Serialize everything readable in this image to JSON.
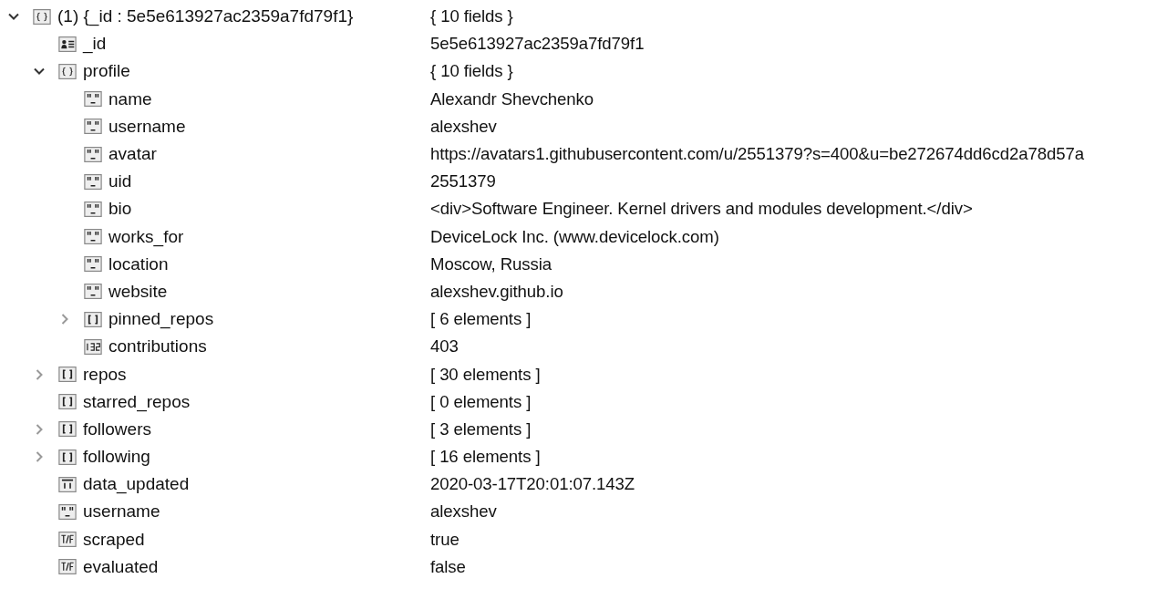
{
  "tree": [
    {
      "key": "(1) {_id : 5e5e613927ac2359a7fd79f1}",
      "value": "{ 10 fields }",
      "kind": "object",
      "expanded": true,
      "children": [
        {
          "key": "_id",
          "value": "5e5e613927ac2359a7fd79f1",
          "kind": "objectid"
        },
        {
          "key": "profile",
          "value": "{ 10 fields }",
          "kind": "object",
          "expanded": true,
          "children": [
            {
              "key": "name",
              "value": "Alexandr Shevchenko",
              "kind": "string"
            },
            {
              "key": "username",
              "value": "alexshev",
              "kind": "string"
            },
            {
              "key": "avatar",
              "value": "https://avatars1.githubusercontent.com/u/2551379?s=400&u=be272674dd6cd2a78d57a",
              "kind": "string"
            },
            {
              "key": "uid",
              "value": "2551379",
              "kind": "string"
            },
            {
              "key": "bio",
              "value": "<div>Software Engineer. Kernel drivers and modules development.</div>",
              "kind": "string"
            },
            {
              "key": "works_for",
              "value": "DeviceLock Inc. (www.devicelock.com)",
              "kind": "string"
            },
            {
              "key": "location",
              "value": "Moscow, Russia",
              "kind": "string"
            },
            {
              "key": "website",
              "value": "alexshev.github.io",
              "kind": "string"
            },
            {
              "key": "pinned_repos",
              "value": "[ 6 elements ]",
              "kind": "array",
              "expanded": false
            },
            {
              "key": "contributions",
              "value": "403",
              "kind": "int32"
            }
          ]
        },
        {
          "key": "repos",
          "value": "[ 30 elements ]",
          "kind": "array",
          "expanded": false
        },
        {
          "key": "starred_repos",
          "value": "[ 0 elements ]",
          "kind": "array"
        },
        {
          "key": "followers",
          "value": "[ 3 elements ]",
          "kind": "array",
          "expanded": false
        },
        {
          "key": "following",
          "value": "[ 16 elements ]",
          "kind": "array",
          "expanded": false
        },
        {
          "key": "data_updated",
          "value": "2020-03-17T20:01:07.143Z",
          "kind": "date"
        },
        {
          "key": "username",
          "value": "alexshev",
          "kind": "string"
        },
        {
          "key": "scraped",
          "value": "true",
          "kind": "bool"
        },
        {
          "key": "evaluated",
          "value": "false",
          "kind": "bool"
        }
      ]
    }
  ]
}
